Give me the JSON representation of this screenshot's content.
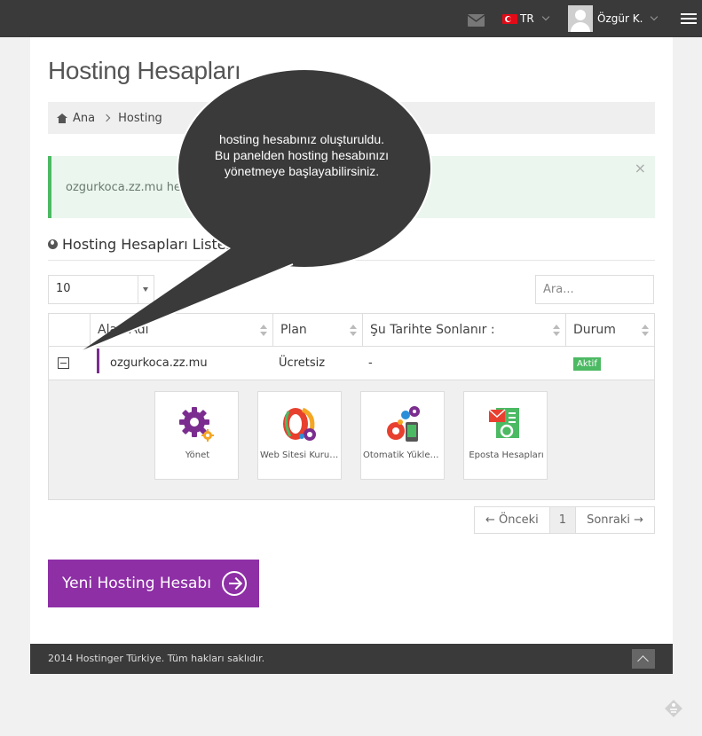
{
  "topbar": {
    "language": "TR",
    "user_name": "Özgür K."
  },
  "page": {
    "title": "Hosting Hesapları",
    "breadcrumb": [
      "Ana",
      "Hosting"
    ]
  },
  "alert": {
    "text": "ozgurkoca.zz.mu hesabınız",
    "close": "×"
  },
  "section": {
    "title": "Hosting Hesapları Listesi"
  },
  "controls": {
    "page_size": "10",
    "search_placeholder": "Ara..."
  },
  "table": {
    "columns": [
      "Alan Adı",
      "Plan",
      "Şu Tarihte Sonlanır :",
      "Durum"
    ],
    "rows": [
      {
        "domain": "ozgurkoca.zz.mu",
        "plan": "Ücretsiz",
        "expires": "-",
        "status": "Aktif"
      }
    ],
    "tiles": [
      {
        "label": "Yönet",
        "icon": "gear-icon"
      },
      {
        "label": "Web Sitesi Kurucusu",
        "icon": "website-builder-icon"
      },
      {
        "label": "Otomatik Yükleyici",
        "icon": "auto-installer-icon"
      },
      {
        "label": "Eposta Hesapları",
        "icon": "email-accounts-icon"
      }
    ]
  },
  "pagination": {
    "prev": "← Önceki",
    "current": "1",
    "next": "Sonraki →"
  },
  "new_button": {
    "label": "Yeni Hosting Hesabı"
  },
  "footer": {
    "text": "2014 Hostinger Türkiye. Tüm hakları saklıdır."
  },
  "tooltip": {
    "text": "hosting hesabınız oluşturuldu. Bu panelden hosting hesabınızı yönetmeye başlayabilirsiniz."
  },
  "colors": {
    "accent": "#8e2fa6",
    "success": "#4cb963",
    "topbar": "#3a3a3a"
  }
}
